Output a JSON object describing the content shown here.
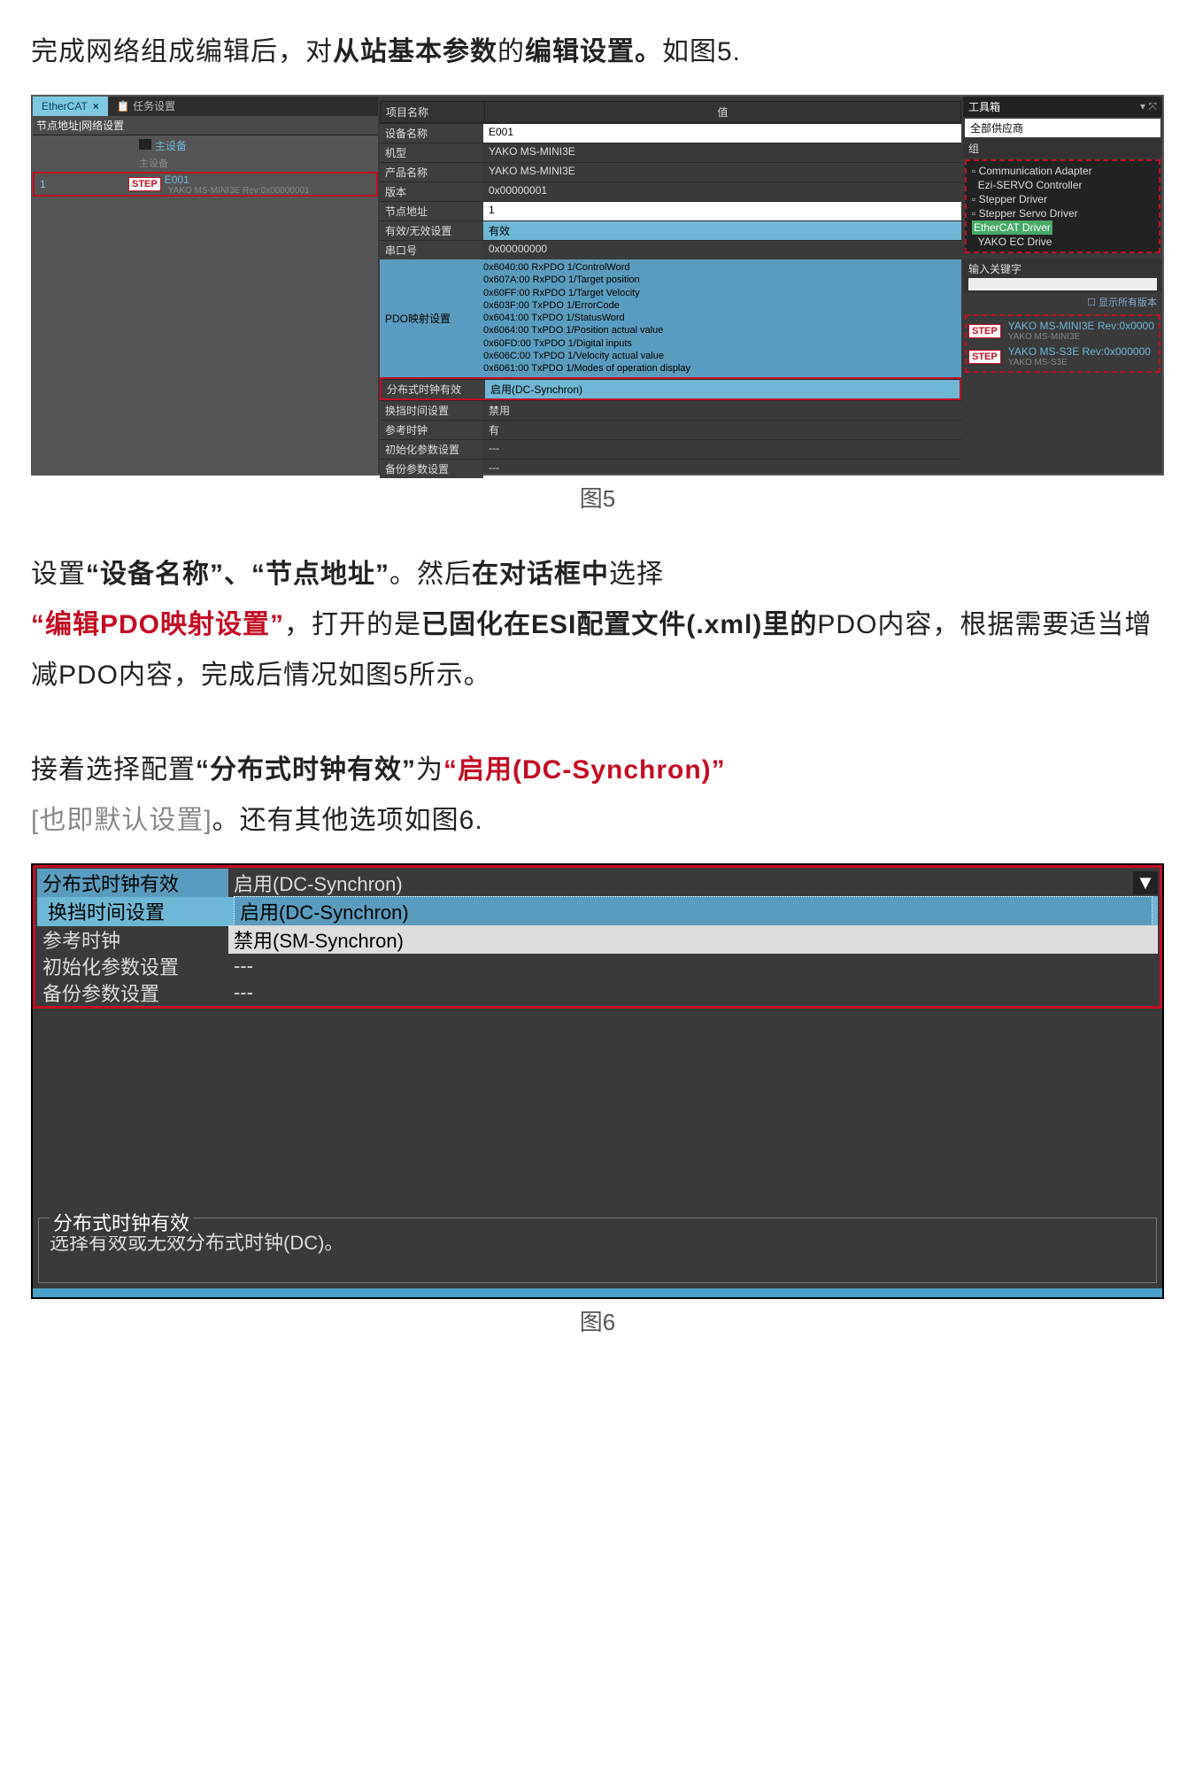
{
  "intro": {
    "t1": "完成网络组成编辑后，对",
    "t2": "从站基本参数",
    "t3": "的",
    "t4": "编辑设置。",
    "t5": "如图5."
  },
  "fig5_caption": "图5",
  "fig6_caption": "图6",
  "tabs": {
    "ethercat": "EtherCAT",
    "close": "×",
    "task": "任务设置"
  },
  "left": {
    "sub": "节点地址|网络设置",
    "master": "主设备",
    "master2": "主设备",
    "idx": "1",
    "step": "STEP",
    "name": "E001",
    "rev": "YAKO MS-MINI3E Rev:0x00000001"
  },
  "prop": {
    "col_name": "项目名称",
    "col_val": "值",
    "rows": {
      "devname": "设备名称",
      "devname_v": "E001",
      "model": "机型",
      "model_v": "YAKO MS-MINI3E",
      "prod": "产品名称",
      "prod_v": "YAKO MS-MINI3E",
      "ver": "版本",
      "ver_v": "0x00000001",
      "node": "节点地址",
      "node_v": "1",
      "valid": "有效/无效设置",
      "valid_v": "有效",
      "serial": "串口号",
      "serial_v": "0x00000000",
      "pdo": "PDO映射设置",
      "pdo_lines": "0x6040:00 RxPDO 1/ControlWord\n0x607A:00 RxPDO 1/Target position\n0x60FF:00 RxPDO 1/Target Velocity\n0x603F:00 TxPDO 1/ErrorCode\n0x6041:00 TxPDO 1/StatusWord\n0x6064:00 TxPDO 1/Position actual value\n0x60FD:00 TxPDO 1/Digital inputs\n0x606C:00 TxPDO 1/Velocity actual value\n0x6061:00 TxPDO 1/Modes of operation display",
      "dc": "分布式时钟有效",
      "dc_v": "启用(DC-Synchron)",
      "shift": "换挡时间设置",
      "shift_v": "禁用",
      "ref": "参考时钟",
      "ref_v": "有",
      "init": "初始化参数设置",
      "init_v": "---",
      "bak": "备份参数设置",
      "bak_v": "---"
    }
  },
  "tool": {
    "title": "工具箱",
    "pin": "▾ ⤧",
    "vendor": "全部供应商",
    "group": "组",
    "drivers": {
      "d1": "Communication Adapter",
      "d2": "Ezi-SERVO Controller",
      "d3": "Stepper Driver",
      "d4": "Stepper Servo Driver",
      "d5": "EtherCAT Driver",
      "d6": "YAKO EC Drive"
    },
    "kw": "输入关键字",
    "show": "显示所有版本",
    "y1": "YAKO MS-MINI3E Rev:0x0000",
    "y1s": "YAKO MS-MINI3E",
    "y2": "YAKO MS-S3E Rev:0x000000",
    "y2s": "YAKO MS-S3E"
  },
  "mid1": {
    "t1": "设置",
    "q1a": "“设备名称”",
    "sep": "、",
    "q1b": "“节点地址”",
    "t2": "。然后",
    "t3": "在对话框中",
    "t4": "选择",
    "q2": "“编辑PDO映射设置”",
    "t5": "，打开的是",
    "t6": "已固化在ESI配置文件(.xml)里的",
    "t7": "PDO内容，根据需要适当增减PDO内容，完成后情况如图5所示。"
  },
  "mid2": {
    "t1": "接着选择配置",
    "q1": "“分布式时钟有效”",
    "t2": "为",
    "q2": "“启用(DC-Synchron)”",
    "t3": "[也即默认设置]",
    "t4": "。还有其他选项如图6."
  },
  "fig6": {
    "r1l": "分布式时钟有效",
    "r1v": "启用(DC-Synchron)",
    "r2l": "换挡时间设置",
    "r2v": "启用(DC-Synchron)",
    "r3l": "参考时钟",
    "r3v": "禁用(SM-Synchron)",
    "r4l": "初始化参数设置",
    "r4v": "---",
    "r5l": "备份参数设置",
    "r5v": "---",
    "legend_t": "分布式时钟有效",
    "legend_b": "选择有效或无效分布式时钟(DC)。",
    "arrow": "▼"
  }
}
